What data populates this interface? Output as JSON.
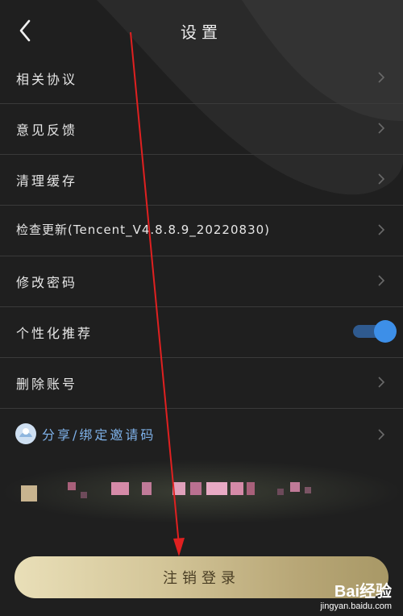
{
  "header": {
    "title": "设置"
  },
  "settings": {
    "items": [
      {
        "label": "相关协议"
      },
      {
        "label": "意见反馈"
      },
      {
        "label": "清理缓存"
      },
      {
        "label": "检查更新(Tencent_V4.8.8.9_20220830)"
      },
      {
        "label": "修改密码"
      },
      {
        "label": "个性化推荐",
        "toggle_on": true
      },
      {
        "label": "删除账号"
      },
      {
        "label": "分享/绑定邀请码",
        "icon": "invite-avatar-icon"
      }
    ]
  },
  "logout": {
    "label": "注销登录"
  },
  "watermark": {
    "brand": "Bai经验",
    "url": "jingyan.baidu.com"
  },
  "colors": {
    "background": "#1f1f1f",
    "toggle": "#3d8fe8",
    "invite_text": "#7fb2ea",
    "logout_gradient_start": "#e9dfb8",
    "logout_gradient_end": "#a89866",
    "annotation_arrow": "#e02020"
  }
}
